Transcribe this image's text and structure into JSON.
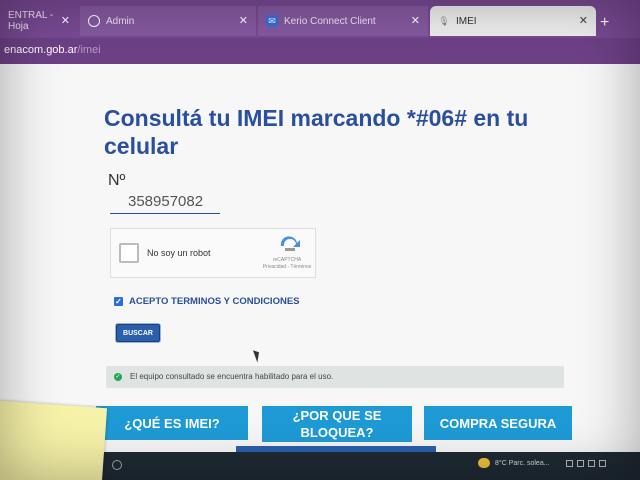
{
  "browser": {
    "tabs": [
      {
        "label": "ENTRAL - Hoja",
        "icon": "none"
      },
      {
        "label": "Admin",
        "icon": "globe-icon"
      },
      {
        "label": "Kerio Connect Client",
        "icon": "mail-icon"
      },
      {
        "label": "IMEI",
        "icon": "microphone-icon"
      }
    ],
    "new_tab": "+",
    "close_glyph": "✕",
    "url_main": "enacom.gob.ar",
    "url_dim": "/imei"
  },
  "page": {
    "title": "Consultá tu IMEI marcando *#06# en tu celular",
    "number_label": "Nº",
    "imei_value": "358957082",
    "captcha": {
      "label": "No soy un robot",
      "brand": "reCAPTCHA",
      "links": "Privacidad - Términos"
    },
    "terms_label": "ACEPTO TERMINOS Y CONDICIONES",
    "search_button": "BUSCAR",
    "status_message": "El equipo consultado se encuentra habilitado para el uso.",
    "buttons": {
      "what_is_imei": "¿QUÉ ES IMEI?",
      "why_blocked": "¿POR QUE SE BLOQUEA?",
      "secure_purchase": "COMPRA SEGURA"
    }
  },
  "taskbar": {
    "weather": "8°C  Parc. solea..."
  },
  "colors": {
    "tab_bar": "#7a4a95",
    "title_blue": "#2a4f9c",
    "button_cyan": "#1e9bd7",
    "success_green": "#23a65a"
  }
}
